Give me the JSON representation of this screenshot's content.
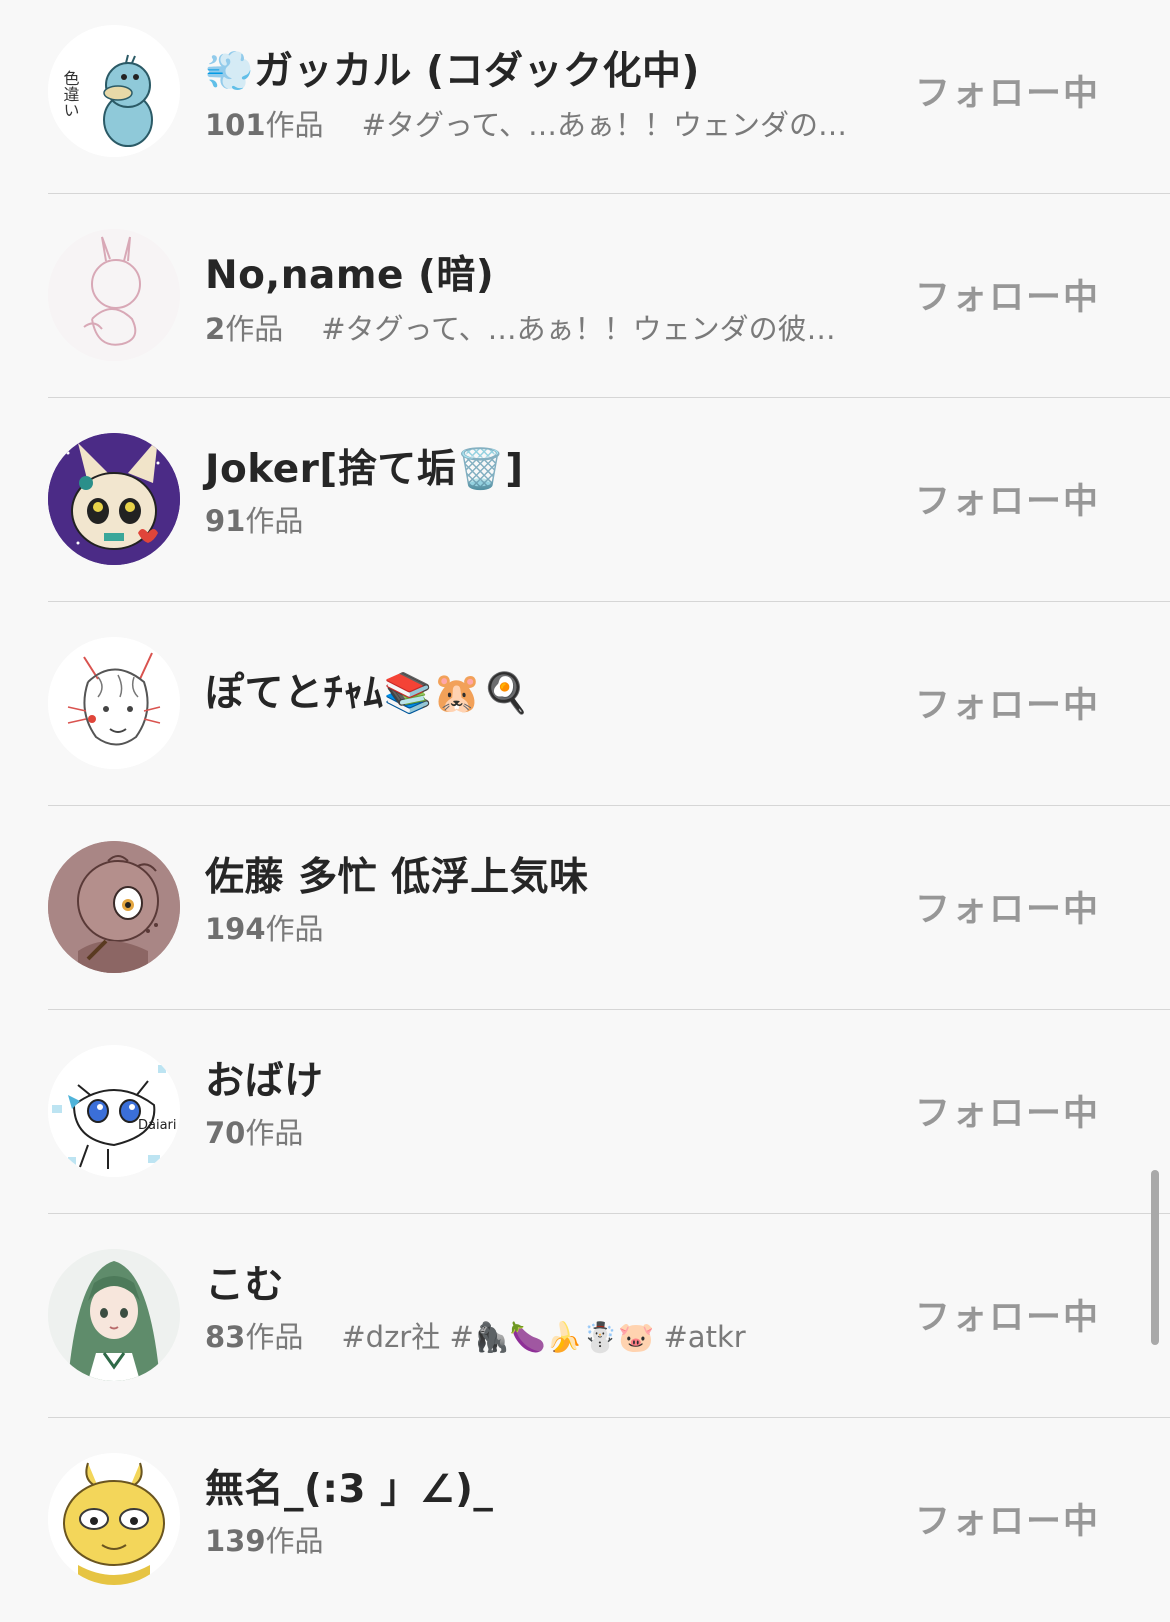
{
  "follow_label": "フォロー中",
  "accent_color": "#979797",
  "users": [
    {
      "name": "💨ガッカル (コダック化中)",
      "count": "101",
      "unit": "作品",
      "bio": "#タグって、…あぁ！！ウェンダの彼…",
      "avatar_icon": "psyduck-avatar-icon",
      "avatar_text": "色違い"
    },
    {
      "name": "No,name (暗)",
      "count": "2",
      "unit": "作品",
      "bio": "#タグって、…あぁ！！ウェンダの彼氏か、",
      "avatar_icon": "sketch-bunny-avatar-icon",
      "avatar_text": ""
    },
    {
      "name": "Joker[捨て垢🗑️]",
      "count": "91",
      "unit": "作品",
      "bio": "",
      "avatar_icon": "joker-character-avatar-icon",
      "avatar_text": ""
    },
    {
      "name": "ぽてとﾁｬﾑ📚🐹🍳",
      "count": "",
      "unit": "",
      "bio": "",
      "avatar_icon": "cat-boy-sketch-avatar-icon",
      "avatar_text": ""
    },
    {
      "name": "佐藤 多忙 低浮上気味",
      "count": "194",
      "unit": "作品",
      "bio": "",
      "avatar_icon": "brown-creature-avatar-icon",
      "avatar_text": ""
    },
    {
      "name": "おばけ",
      "count": "70",
      "unit": "作品",
      "bio": "",
      "avatar_icon": "blue-eyed-cat-avatar-icon",
      "avatar_text": "Daiari"
    },
    {
      "name": "こむ",
      "count": "83",
      "unit": "作品",
      "bio": "#dzr社 #🦍🍆🍌☃️🐷 #atkr",
      "avatar_icon": "green-hair-girl-avatar-icon",
      "avatar_text": ""
    },
    {
      "name": "無名_(:3 」∠)_",
      "count": "139",
      "unit": "作品",
      "bio": "",
      "avatar_icon": "yellow-character-avatar-icon",
      "avatar_text": ""
    }
  ]
}
